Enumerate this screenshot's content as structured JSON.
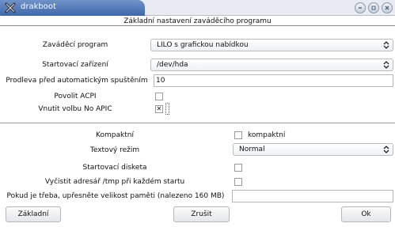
{
  "window": {
    "title": "drakboot",
    "icon": "drakx-x-icon",
    "controls": [
      "minimize-icon",
      "maximize-icon",
      "close-icon"
    ]
  },
  "dialog": {
    "header": "Základní nastavení zaváděcího programu"
  },
  "boot": {
    "bootloader_label": "Zaváděcí program",
    "bootloader_value": "LILO s grafickou nabídkou",
    "device_label": "Startovací zařízení",
    "device_value": "/dev/hda",
    "delay_label": "Prodleva před automatickým spuštěním",
    "delay_value": "10",
    "acpi_label": "Povolit ACPI",
    "acpi_checked": false,
    "noapic_label": "Vnutit volbu No APIC",
    "noapic_checked": true,
    "noapic_mark": "✕"
  },
  "options": {
    "compact_label": "Kompaktní",
    "compact_checkbox_label": "kompaktní",
    "compact_checked": false,
    "textmode_label": "Textový režim",
    "textmode_value": "Normal",
    "bootdisk_label": "Startovací disketa",
    "bootdisk_checked": false,
    "cleantmp_label": "Vyčistit adresář /tmp při každém startu",
    "cleantmp_checked": false,
    "memory_label": "Pokud je třeba, upřesněte velikost paměti (nalezeno 160 MB)",
    "memory_value": ""
  },
  "buttons": {
    "basic": "Základní",
    "cancel": "Zrušit",
    "ok": "Ok"
  },
  "colors": {
    "title_tab": "#4f78b8",
    "title_bar": "#e8ecf2",
    "window_background": "#ffffff"
  }
}
